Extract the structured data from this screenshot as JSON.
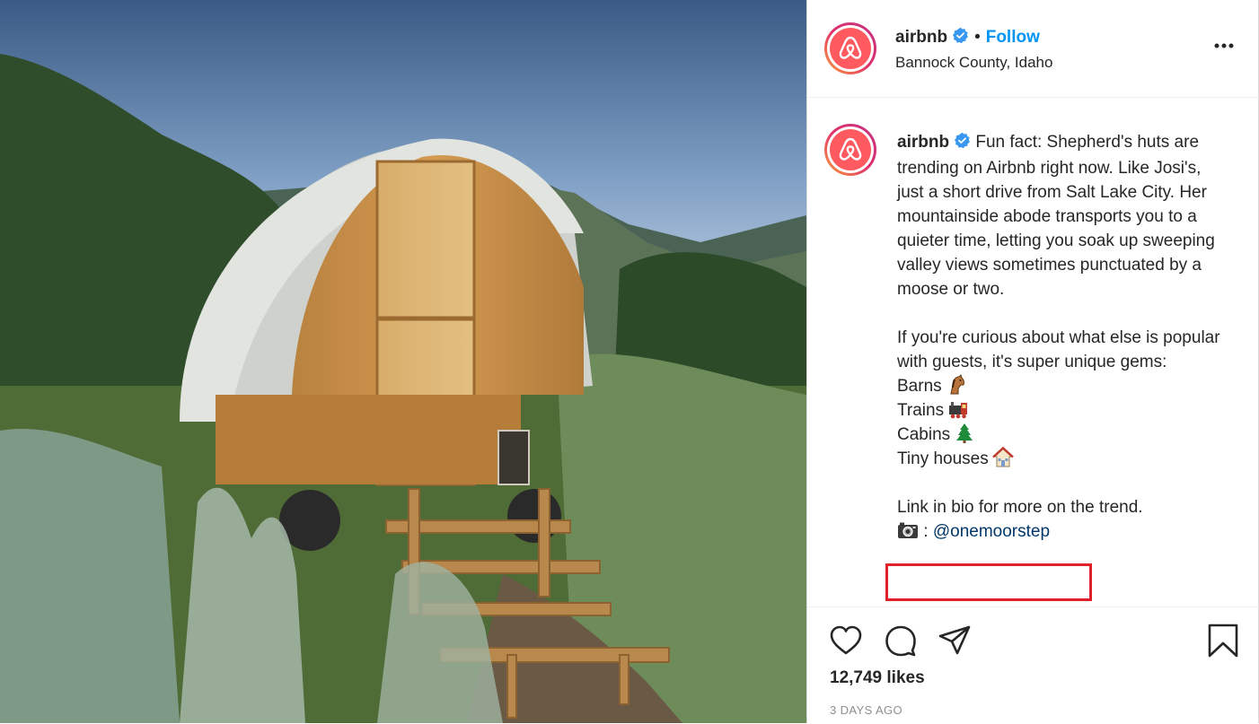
{
  "post": {
    "username": "airbnb",
    "follow_label": "Follow",
    "separator": "•",
    "location": "Bannock County, Idaho",
    "caption_username": "airbnb",
    "caption_lines": [
      "Fun fact: Shepherd's huts are trending on Airbnb right now. Like Josi's, just a short drive from Salt Lake City. Her mountainside abode transports you to a quieter time, letting you soak up sweeping valley views sometimes punctuated by a moose or two.",
      "If you're curious about what else is popular with guests, it's super unique gems:"
    ],
    "list": [
      {
        "label": "Barns",
        "icon": "horse-emoji"
      },
      {
        "label": "Trains",
        "icon": "train-emoji"
      },
      {
        "label": "Cabins",
        "icon": "tree-emoji"
      },
      {
        "label": "Tiny houses",
        "icon": "house-emoji"
      }
    ],
    "link_text": "Link in bio for more on the trend.",
    "credit_icon": "camera-emoji",
    "credit_separator": ":",
    "credit_handle": "@onemoorstep",
    "likes": "12,749 likes",
    "timestamp": "3 DAYS AGO"
  },
  "colors": {
    "brand": "#ff5a5f",
    "link_blue": "#0095f6",
    "mention": "#00376b",
    "highlight_box": "#e0202b"
  }
}
